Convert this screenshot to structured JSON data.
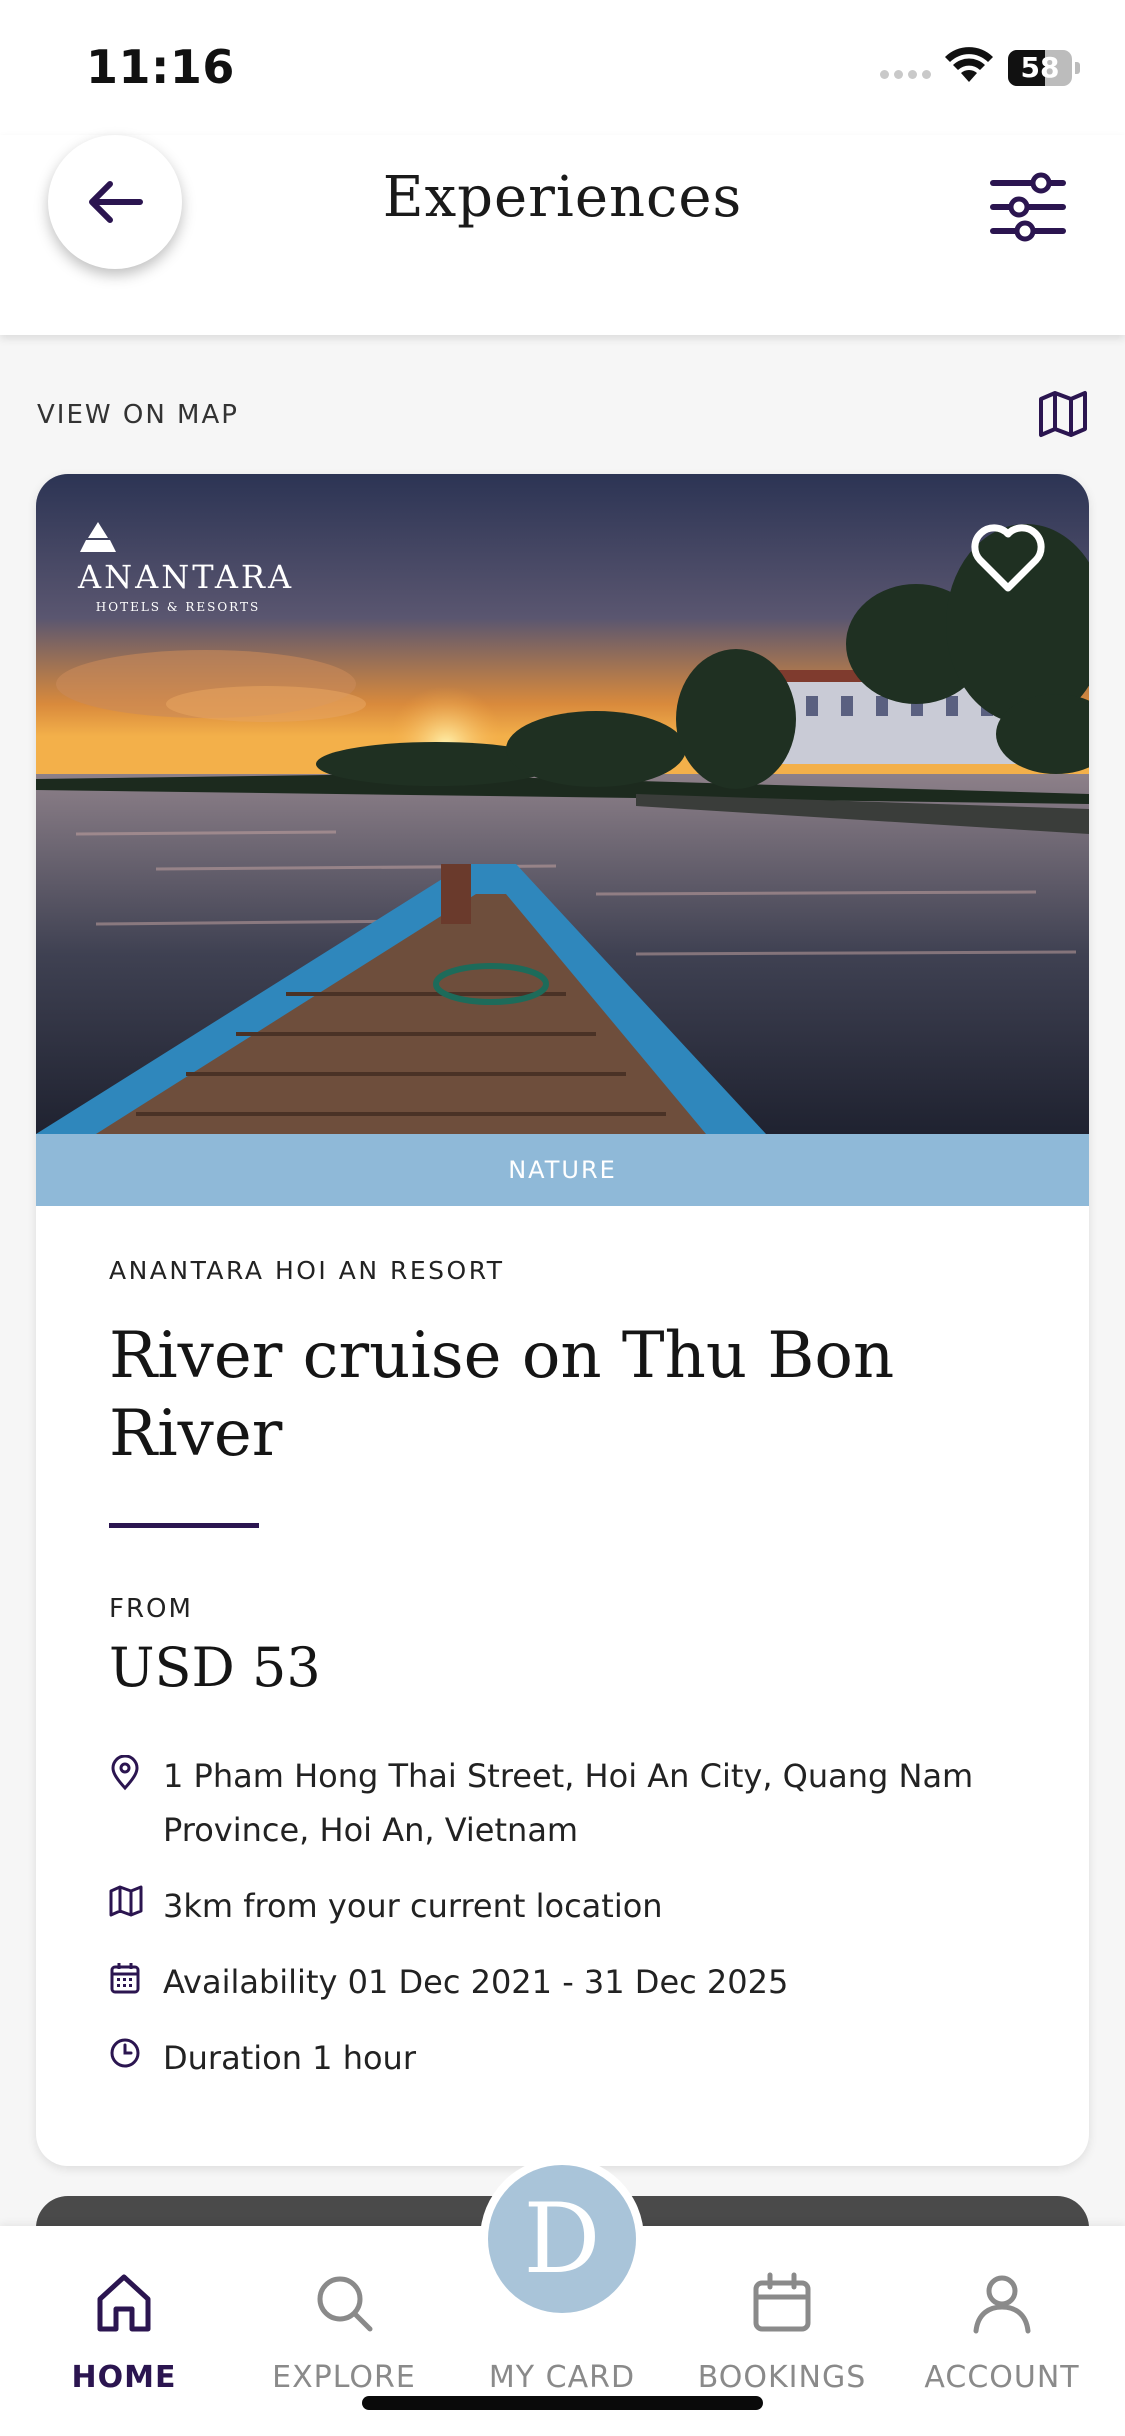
{
  "status_bar": {
    "time": "11:16",
    "battery": "58",
    "battery_level_percent": 58
  },
  "header": {
    "title": "Experiences",
    "back_icon": "arrow-left-icon",
    "filter_icon": "sliders-icon"
  },
  "map_row": {
    "label": "VIEW ON MAP",
    "icon": "map-icon"
  },
  "card": {
    "brand": {
      "name": "ANANTARA",
      "tagline": "HOTELS & RESORTS"
    },
    "category": "NATURE",
    "resort": "ANANTARA HOI AN RESORT",
    "title": "River cruise on Thu Bon River",
    "from_label": "FROM",
    "price": "USD 53",
    "info": [
      {
        "icon": "location-pin-icon",
        "text": "1 Pham Hong Thai Street, Hoi An City, Quang Nam Province, Hoi An, Vietnam"
      },
      {
        "icon": "map-icon",
        "text": "3km from your current location"
      },
      {
        "icon": "calendar-icon",
        "text": "Availability 01 Dec 2021 - 31 Dec 2025"
      },
      {
        "icon": "clock-icon",
        "text": "Duration 1 hour"
      }
    ]
  },
  "bottom_nav": {
    "items": [
      {
        "label": "HOME",
        "icon": "home-icon",
        "active": true
      },
      {
        "label": "EXPLORE",
        "icon": "search-icon",
        "active": false
      },
      {
        "label": "MY CARD",
        "icon": "card-logo-icon",
        "active": false
      },
      {
        "label": "BOOKINGS",
        "icon": "calendar-icon",
        "active": false
      },
      {
        "label": "ACCOUNT",
        "icon": "user-icon",
        "active": false
      }
    ],
    "card_logo": "D"
  },
  "colors": {
    "brand_purple": "#2b1550",
    "category_blue": "#8fb9d8",
    "inactive_gray": "#8a8a8a"
  }
}
